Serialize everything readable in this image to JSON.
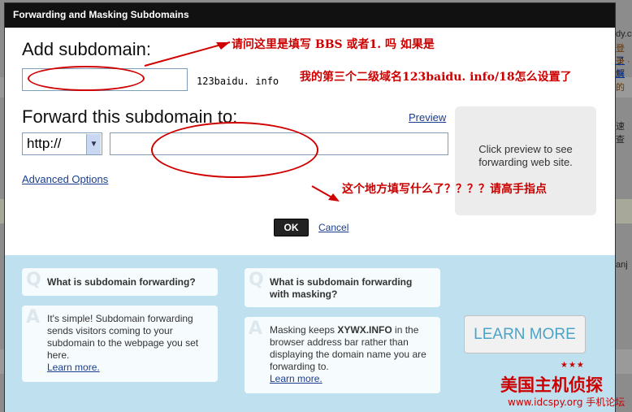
{
  "dialog": {
    "title": "Forwarding and Masking Subdomains",
    "add_subdomain_label": "Add subdomain:",
    "subdomain_value": "",
    "domain_suffix": "123baidu. info",
    "forward_label": "Forward this subdomain to:",
    "preview_link": "Preview",
    "protocol_value": "http://",
    "forward_url_value": "",
    "preview_panel_text": "Click preview to see forwarding web site.",
    "advanced_options_link": "Advanced Options",
    "ok_label": "OK",
    "cancel_label": "Cancel"
  },
  "annotations": {
    "note1": "请问这里是填写 BBS 或者1. 吗 如果是",
    "note2": "我的第三个二级域名123baidu. info/18怎么设置了",
    "note3": "这个地方填写什么了？？？？请高手指点"
  },
  "help": {
    "q1_title": "What is subdomain forwarding?",
    "a1_text": "It's simple! Subdomain forwarding sends visitors coming to your subdomain to the webpage you set here.",
    "a1_link": "Learn more.",
    "q2_title": "What is subdomain forwarding with masking?",
    "a2_text_before": "Masking keeps ",
    "a2_domain": "XYWX.INFO",
    "a2_text_after": " in the browser address bar rather than displaying the domain name you are forwarding to.",
    "a2_link": "Learn more.",
    "q_letter": "Q",
    "a_letter": "A",
    "learn_more_button": "LEARN MORE"
  },
  "background": {
    "edge_text_1": "dy.co",
    "edge_text_2": "登录 · 您的",
    "edge_text_3": "了解",
    "edge_text_4": "速查",
    "edge_text_5": "anj"
  },
  "watermark": {
    "cn": "美国主机侦探",
    "url": "www.idcspy.org 手机论坛"
  },
  "colors": {
    "annotation_red": "#cc0000",
    "link_blue": "#1a3d8f",
    "help_bg": "#bfe0ee",
    "learn_more_text": "#4aa3c8"
  }
}
